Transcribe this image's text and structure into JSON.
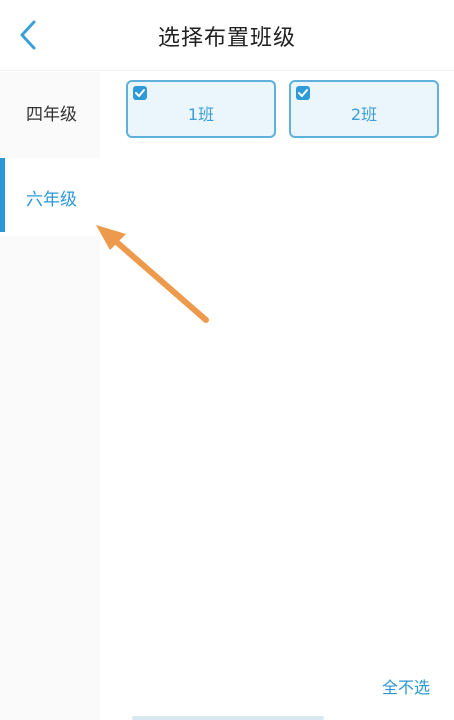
{
  "header": {
    "title": "选择布置班级",
    "back_icon": "chevron-left-icon"
  },
  "sidebar": {
    "items": [
      {
        "label": "四年级",
        "active": false
      },
      {
        "label": "六年级",
        "active": true
      }
    ]
  },
  "classes": [
    {
      "label": "1班",
      "checked": true
    },
    {
      "label": "2班",
      "checked": true
    }
  ],
  "footer": {
    "deselect_all": "全不选"
  },
  "colors": {
    "accent": "#2c97d6",
    "annotation_arrow": "#ee9a4d"
  }
}
